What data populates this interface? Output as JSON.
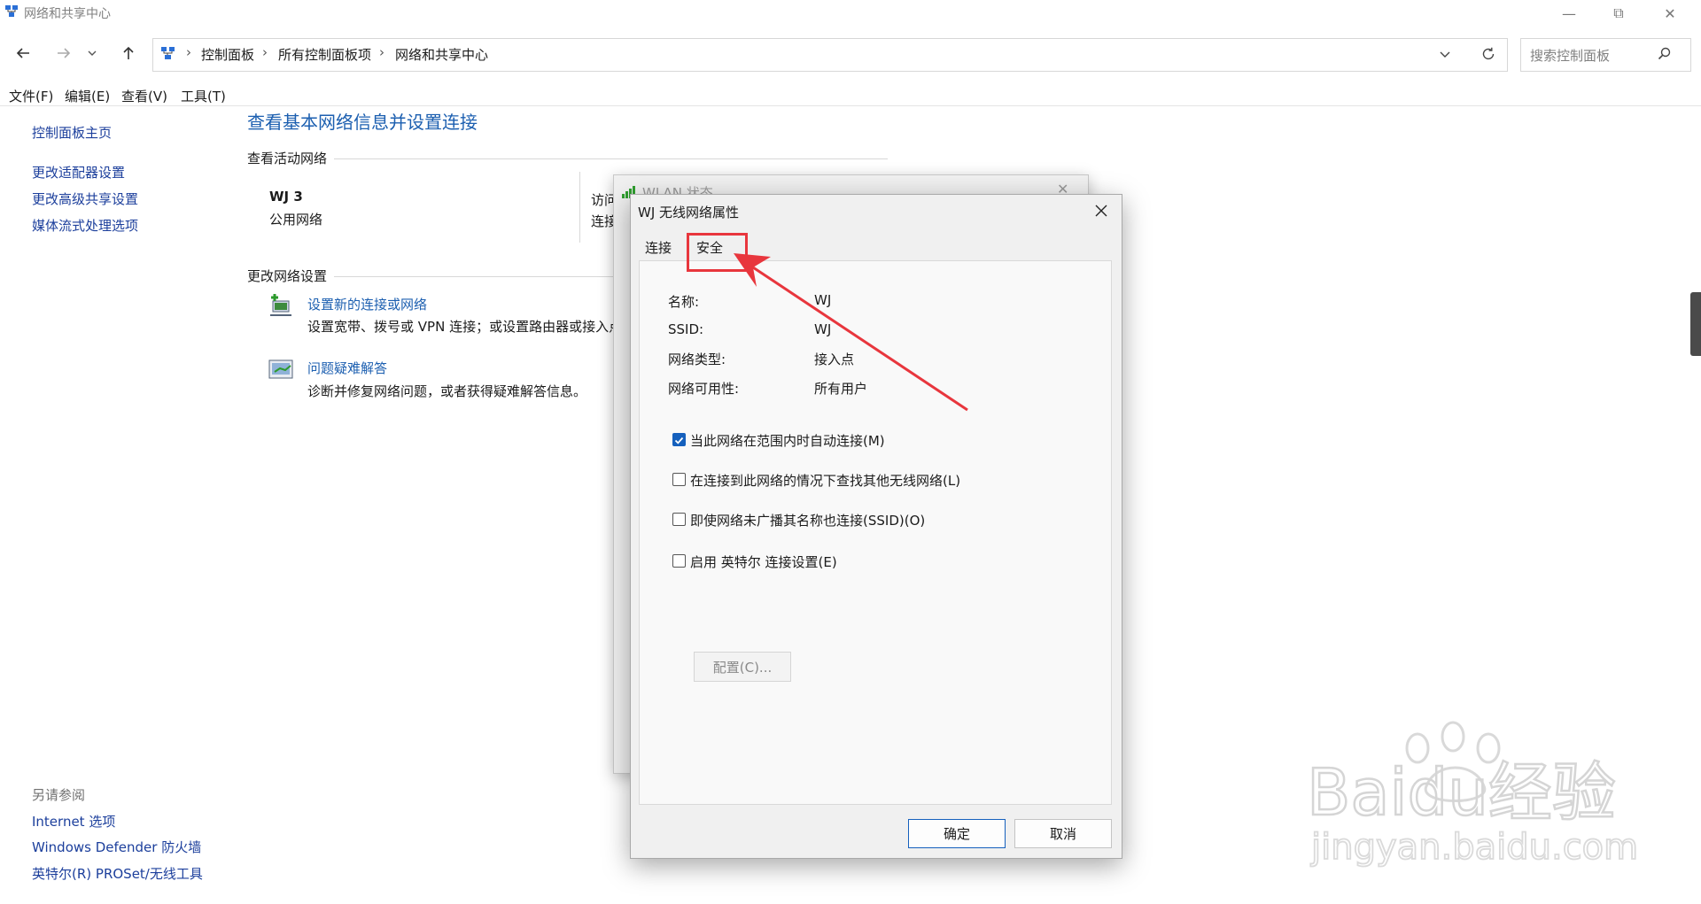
{
  "window": {
    "title": "网络和共享中心",
    "minimize": "—",
    "maximize": "⧉",
    "close": "✕"
  },
  "address": {
    "crumbs": [
      "控制面板",
      "所有控制面板项",
      "网络和共享中心"
    ],
    "separator": "›",
    "search_placeholder": "搜索控制面板"
  },
  "menubar": [
    "文件(F)",
    "编辑(E)",
    "查看(V)",
    "工具(T)"
  ],
  "left": {
    "links": [
      "控制面板主页",
      "更改适配器设置",
      "更改高级共享设置",
      "媒体流式处理选项"
    ],
    "see_also_title": "另请参阅",
    "see_also": [
      "Internet 选项",
      "Windows Defender 防火墙",
      "英特尔(R) PROSet/无线工具"
    ]
  },
  "main": {
    "title": "查看基本网络信息并设置连接",
    "active_section": "查看活动网络",
    "network_name": "WJ 3",
    "network_type": "公用网络",
    "access_label_partial": "访问",
    "connection_label_partial": "连接",
    "change_section": "更改网络设置",
    "items": [
      {
        "title": "设置新的连接或网络",
        "desc": "设置宽带、拨号或 VPN 连接；或设置路由器或接入点"
      },
      {
        "title": "问题疑难解答",
        "desc": "诊断并修复网络问题，或者获得疑难解答信息。"
      }
    ]
  },
  "back_dialog": {
    "title": "WLAN 状态"
  },
  "dialog": {
    "title": "WJ 无线网络属性",
    "tabs": [
      "连接",
      "安全"
    ],
    "props": [
      {
        "label": "名称:",
        "value": "WJ"
      },
      {
        "label": "SSID:",
        "value": "WJ"
      },
      {
        "label": "网络类型:",
        "value": "接入点"
      },
      {
        "label": "网络可用性:",
        "value": "所有用户"
      }
    ],
    "checkboxes": [
      {
        "label": "当此网络在范围内时自动连接(M)",
        "checked": true
      },
      {
        "label": "在连接到此网络的情况下查找其他无线网络(L)",
        "checked": false
      },
      {
        "label": "即使网络未广播其名称也连接(SSID)(O)",
        "checked": false
      },
      {
        "label": "启用 英特尔 连接设置(E)",
        "checked": false
      }
    ],
    "config_button": "配置(C)...",
    "ok": "确定",
    "cancel": "取消"
  },
  "watermark": {
    "brand": "Baidu经验",
    "url": "jingyan.baidu.com"
  },
  "colors": {
    "link": "#1c5fb0",
    "highlight": "#e8363d",
    "checkbox": "#1560bd"
  }
}
